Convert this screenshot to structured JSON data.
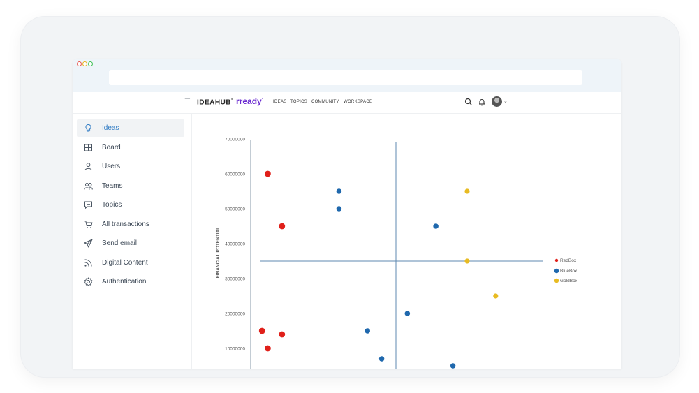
{
  "browser": {
    "controls": [
      "close",
      "minimize",
      "maximize"
    ]
  },
  "header": {
    "menu_icon": "hamburger-icon",
    "brand": "IDEAHUB",
    "brand_suffix": "°",
    "partner": "rready",
    "partner_suffix": "°",
    "nav": [
      "IDEAS",
      "TOPICS",
      "COMMUNITY",
      "WORKSPACE"
    ],
    "active_nav": "IDEAS",
    "icons": [
      "search-icon",
      "bell-icon",
      "avatar",
      "chevron-down-icon"
    ]
  },
  "sidebar": {
    "items": [
      {
        "label": "Ideas",
        "icon": "lightbulb-icon",
        "active": true
      },
      {
        "label": "Board",
        "icon": "board-icon",
        "active": false
      },
      {
        "label": "Users",
        "icon": "user-icon",
        "active": false
      },
      {
        "label": "Teams",
        "icon": "team-icon",
        "active": false
      },
      {
        "label": "Topics",
        "icon": "chat-icon",
        "active": false
      },
      {
        "label": "All transactions",
        "icon": "cart-icon",
        "active": false
      },
      {
        "label": "Send email",
        "icon": "send-icon",
        "active": false
      },
      {
        "label": "Digital Content",
        "icon": "rss-icon",
        "active": false
      },
      {
        "label": "Authentication",
        "icon": "gear-icon",
        "active": false
      }
    ]
  },
  "colors": {
    "accent": "#2f7bc4",
    "brand_purple": "#6a2bd0",
    "red": "#e0201a",
    "blue": "#1f68ad",
    "gold": "#e8bb22",
    "axis": "#5f88b0"
  },
  "chart_data": {
    "type": "scatter",
    "ylabel": "FINANCIAL POTENTIAL",
    "xlabel": "",
    "yticks": [
      70000000,
      60000000,
      50000000,
      40000000,
      30000000,
      20000000,
      10000000
    ],
    "ytick_labels": [
      "70000000",
      "60000000",
      "50000000",
      "40000000",
      "30000000",
      "20000000",
      "10000000"
    ],
    "ylim": [
      6000000,
      70000000
    ],
    "xlim": [
      0,
      10
    ],
    "quadrant_x": 5,
    "quadrant_y": 35000000,
    "legend_position": "right",
    "series": [
      {
        "name": "RedBox",
        "color": "#e0201a",
        "points": [
          [
            0.5,
            60000000
          ],
          [
            1.0,
            45000000
          ],
          [
            0.3,
            15000000
          ],
          [
            1.0,
            14000000
          ],
          [
            0.5,
            10000000
          ]
        ]
      },
      {
        "name": "BlueBox",
        "color": "#1f68ad",
        "points": [
          [
            3.0,
            55000000
          ],
          [
            3.0,
            50000000
          ],
          [
            6.4,
            45000000
          ],
          [
            5.4,
            20000000
          ],
          [
            4.0,
            15000000
          ],
          [
            4.5,
            7000000
          ],
          [
            7.0,
            5000000
          ]
        ]
      },
      {
        "name": "GoldBox",
        "color": "#e8bb22",
        "points": [
          [
            7.5,
            55000000
          ],
          [
            7.5,
            35000000
          ],
          [
            8.5,
            25000000
          ]
        ]
      }
    ]
  }
}
